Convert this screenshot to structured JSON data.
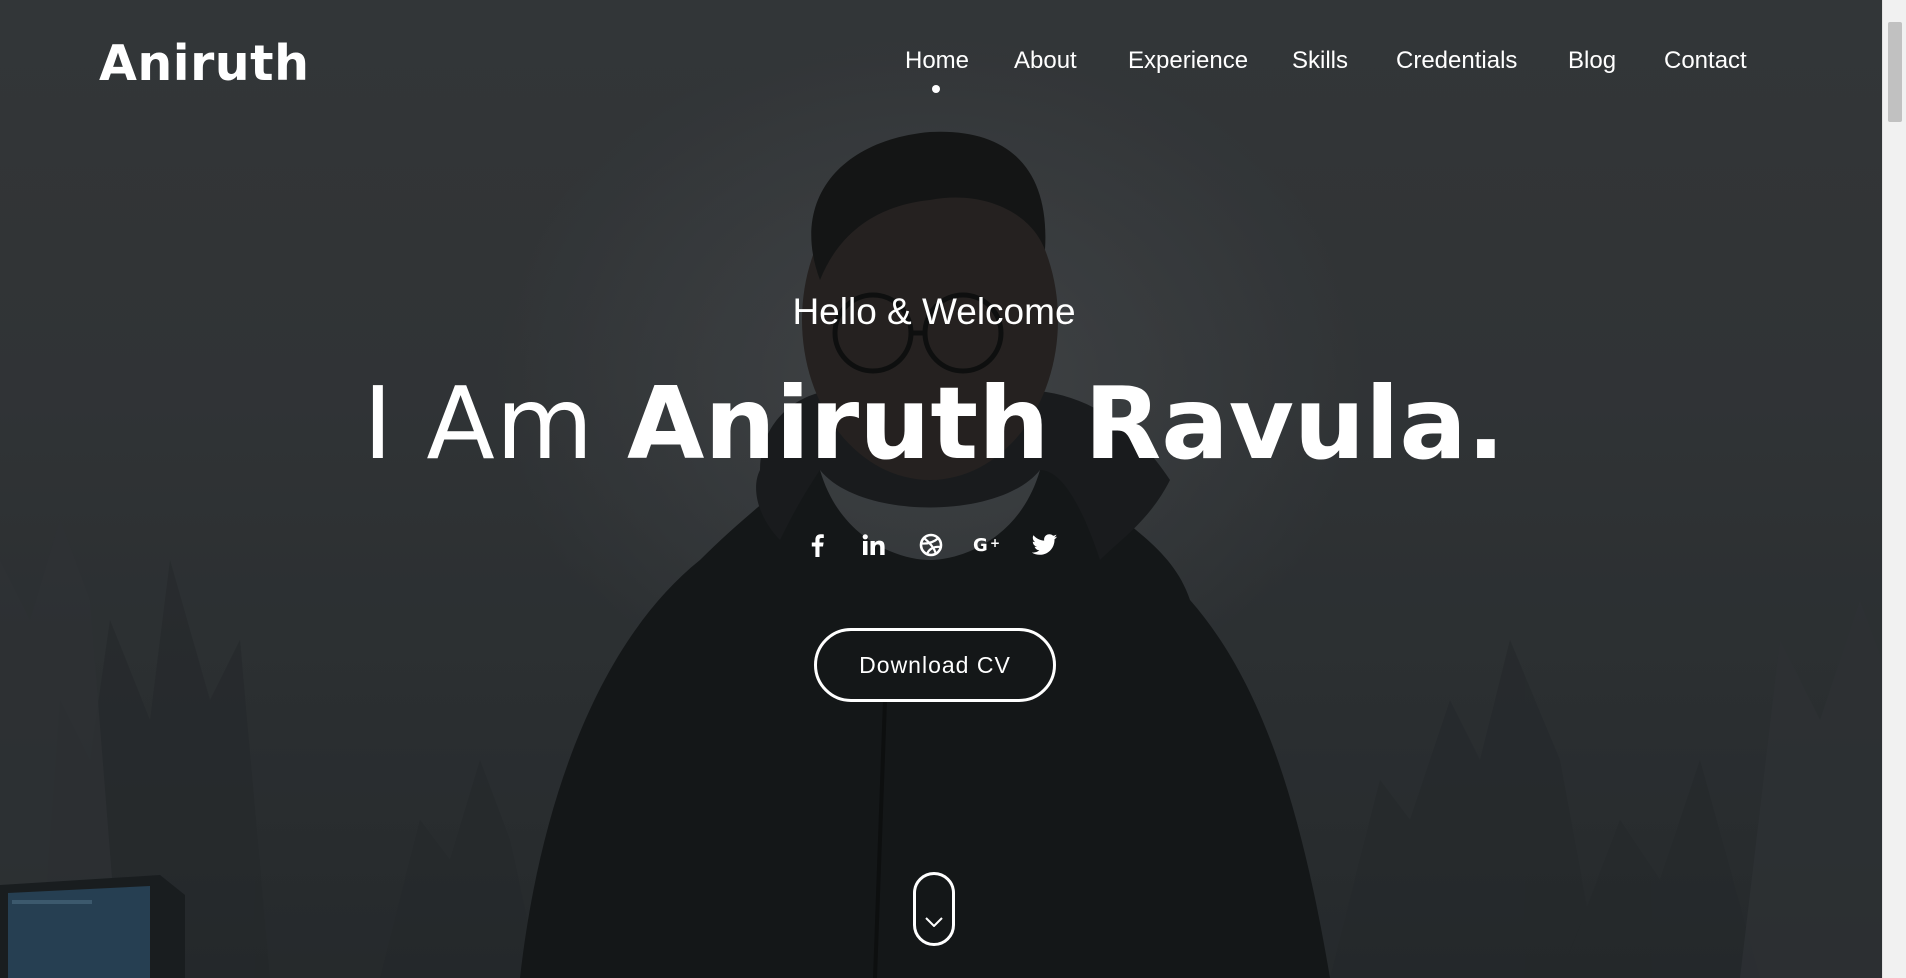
{
  "brand": {
    "logo_text": "Aniruth"
  },
  "nav": {
    "items": [
      {
        "label": "Home",
        "active": true
      },
      {
        "label": "About",
        "active": false
      },
      {
        "label": "Experience",
        "active": false
      },
      {
        "label": "Skills",
        "active": false
      },
      {
        "label": "Credentials",
        "active": false
      },
      {
        "label": "Blog",
        "active": false
      },
      {
        "label": "Contact",
        "active": false
      }
    ]
  },
  "hero": {
    "greeting": "Hello & Welcome",
    "headline_prefix": "I Am ",
    "headline_name": "Aniruth Ravula.",
    "cv_button_label": "Download CV",
    "social": [
      {
        "icon": "facebook-icon"
      },
      {
        "icon": "linkedin-icon"
      },
      {
        "icon": "dribbble-icon"
      },
      {
        "icon": "google-plus-icon"
      },
      {
        "icon": "twitter-icon"
      }
    ],
    "scroll_icon": "chevron-down-icon"
  },
  "colors": {
    "text": "#ffffff",
    "background": "#2e3134",
    "scrollbar_track": "#f1f1f1",
    "scrollbar_thumb": "#c1c1c1"
  }
}
